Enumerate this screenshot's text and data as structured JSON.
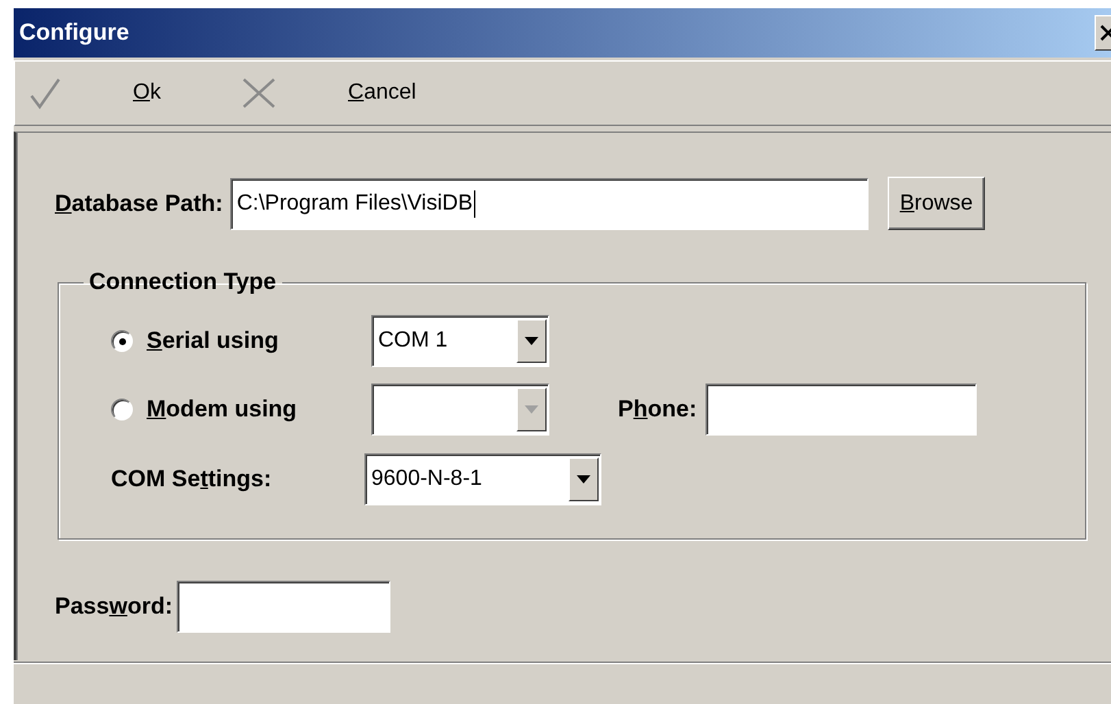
{
  "window": {
    "title": "Configure"
  },
  "toolbar": [
    {
      "kind": "check",
      "label": {
        "key": "O",
        "post": "k"
      }
    },
    {
      "kind": "cross",
      "label": {
        "key": "C",
        "post": "ancel"
      }
    }
  ],
  "database_path": {
    "label": {
      "key": "D",
      "post": "atabase Path:"
    },
    "value": "C:\\Program Files\\VisiDB",
    "focused": true
  },
  "browse_button": {
    "label": {
      "key": "B",
      "post": "rowse"
    }
  },
  "connection_type": {
    "legend": "Connection Type",
    "options": [
      {
        "selected": true,
        "label": {
          "key": "S",
          "post": "erial using"
        },
        "port": {
          "value": "COM 1",
          "disabled": false
        }
      },
      {
        "selected": false,
        "label": {
          "key": "M",
          "post": "odem using"
        },
        "port": {
          "disabled": true
        }
      }
    ],
    "phone": {
      "label": {
        "pre": "P",
        "key": "h",
        "post": "one:"
      }
    },
    "com_settings": {
      "label": {
        "pre": "COM Se",
        "key": "t",
        "post": "tings:"
      },
      "value": "9600-N-8-1",
      "disabled": false
    }
  },
  "password": {
    "label": {
      "pre": "Pass",
      "key": "w",
      "post": "ord:"
    }
  }
}
